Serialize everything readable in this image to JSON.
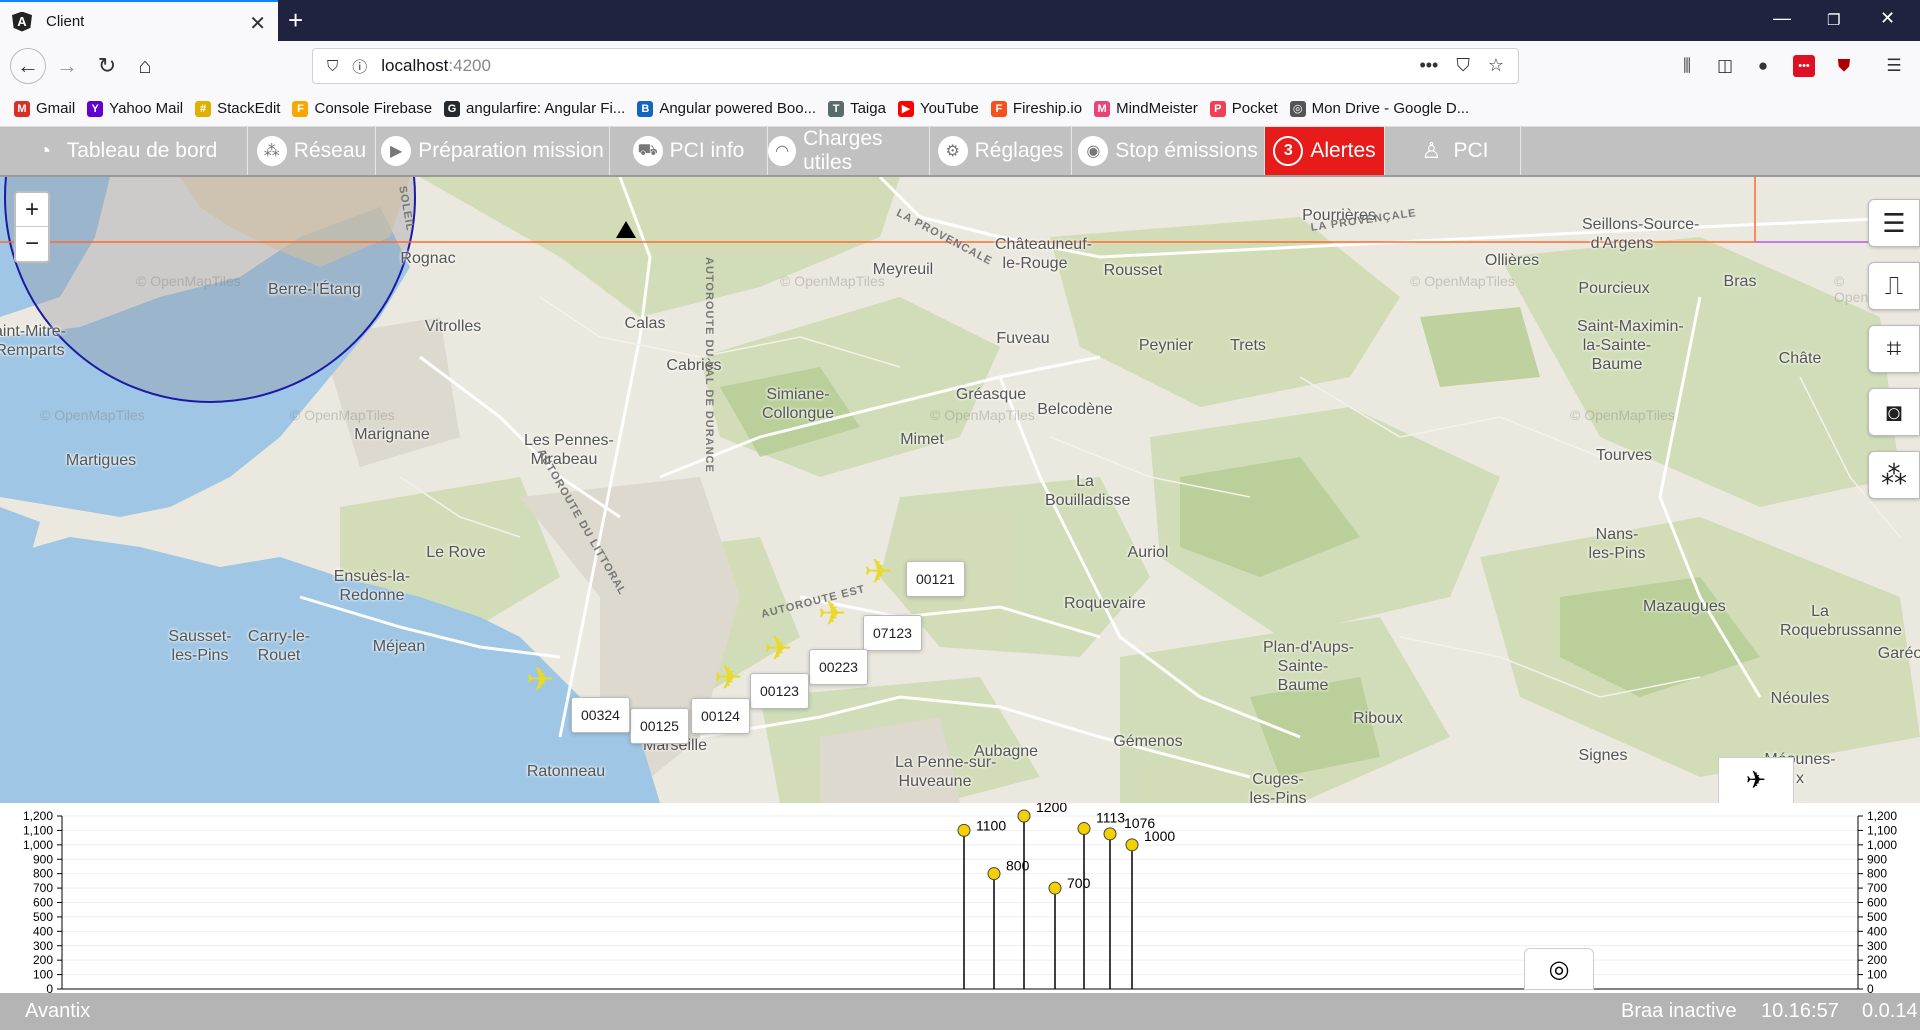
{
  "browser": {
    "tab_title": "Client",
    "tab_icon": "A",
    "url_host": "localhost",
    "url_port": ":4200",
    "bookmarks": [
      {
        "label": "Gmail",
        "icon": "gmail-icon",
        "color": "#d93025",
        "glyph": "M"
      },
      {
        "label": "Yahoo Mail",
        "icon": "yahoo-icon",
        "color": "#6001d2",
        "glyph": "Y"
      },
      {
        "label": "StackEdit",
        "icon": "stackedit-icon",
        "color": "#e0b000",
        "glyph": "#"
      },
      {
        "label": "Console Firebase",
        "icon": "firebase-icon",
        "color": "#f6a800",
        "glyph": "F"
      },
      {
        "label": "angularfire: Angular Fi...",
        "icon": "github-icon",
        "color": "#24292e",
        "glyph": "G"
      },
      {
        "label": "Angular powered Boo...",
        "icon": "bootstrap-icon",
        "color": "#1565c0",
        "glyph": "B"
      },
      {
        "label": "Taiga",
        "icon": "taiga-icon",
        "color": "#5a6b6b",
        "glyph": "T"
      },
      {
        "label": "YouTube",
        "icon": "youtube-icon",
        "color": "#ff0000",
        "glyph": "▶"
      },
      {
        "label": "Fireship.io",
        "icon": "fireship-icon",
        "color": "#f4511e",
        "glyph": "F"
      },
      {
        "label": "MindMeister",
        "icon": "mindmeister-icon",
        "color": "#e84576",
        "glyph": "M"
      },
      {
        "label": "Pocket",
        "icon": "pocket-icon",
        "color": "#ef4056",
        "glyph": "P"
      },
      {
        "label": "Mon Drive - Google D...",
        "icon": "globe-icon",
        "color": "#555555",
        "glyph": "◎"
      }
    ]
  },
  "menu": {
    "items": [
      {
        "label": "Tableau de bord",
        "icon": "dashboard-icon",
        "glyph": "◔"
      },
      {
        "label": "Réseau",
        "icon": "network-icon",
        "glyph": "⁂"
      },
      {
        "label": "Préparation mission",
        "icon": "play-icon",
        "glyph": "▶"
      },
      {
        "label": "PCI info",
        "icon": "truck-icon",
        "glyph": "⛟"
      },
      {
        "label": "Charges utiles",
        "icon": "wifi-icon",
        "glyph": "◠"
      },
      {
        "label": "Réglages",
        "icon": "settings-icon",
        "glyph": "⚙"
      },
      {
        "label": "Stop émissions",
        "icon": "stop-icon",
        "glyph": "◉"
      },
      {
        "label": "Alertes",
        "icon": "alert-badge",
        "glyph": "3"
      },
      {
        "label": "PCI",
        "icon": "user-icon",
        "glyph": "♙"
      }
    ],
    "alert_color": "#e81b1b"
  },
  "map": {
    "places": [
      {
        "name": "Rognac"
      },
      {
        "name": "Berre-l'Étang"
      },
      {
        "name": "Vitrolles"
      },
      {
        "name": "Calas"
      },
      {
        "name": "Meyreuil"
      },
      {
        "name": "Châteauneuf-\nle-Rouge"
      },
      {
        "name": "Rousset"
      },
      {
        "name": "Pourrières"
      },
      {
        "name": "Seillons-Source-\nd'Argens"
      },
      {
        "name": "Ollières"
      },
      {
        "name": "Bras"
      },
      {
        "name": "Pourcieux"
      },
      {
        "name": "Saint-Maximin-\nla-Sainte-\nBaume"
      },
      {
        "name": "aint-Mitre-\nRemparts"
      },
      {
        "name": "Cabriès"
      },
      {
        "name": "Simiane-\nCollongue"
      },
      {
        "name": "Fuveau"
      },
      {
        "name": "Peynier"
      },
      {
        "name": "Trets"
      },
      {
        "name": "Gréasque"
      },
      {
        "name": "Belcodène"
      },
      {
        "name": "Marignane"
      },
      {
        "name": "Les Pennes-\nMirabeau"
      },
      {
        "name": "Mimet"
      },
      {
        "name": "Martigues"
      },
      {
        "name": "La\nBouilladisse"
      },
      {
        "name": "Tourves"
      },
      {
        "name": "Nans-\nles-Pins"
      },
      {
        "name": "Le Rove"
      },
      {
        "name": "Auriol"
      },
      {
        "name": "Ensuès-la-\nRedonne"
      },
      {
        "name": "Roquevaire"
      },
      {
        "name": "Mazaugues"
      },
      {
        "name": "La\nRoquebrussanne"
      },
      {
        "name": "Sausset-\nles-Pins"
      },
      {
        "name": "Carry-le-\nRouet"
      },
      {
        "name": "Méjean"
      },
      {
        "name": "Plan-d'Aups-\nSainte-\nBaume"
      },
      {
        "name": "Garéo"
      },
      {
        "name": "Néoules"
      },
      {
        "name": "Riboux"
      },
      {
        "name": "Aubagne"
      },
      {
        "name": "Gémenos"
      },
      {
        "name": "La Penne-sur-\nHuveaune"
      },
      {
        "name": "Signes"
      },
      {
        "name": "Ratonneau"
      },
      {
        "name": "Cuges-\nles-Pins"
      },
      {
        "name": "Châte"
      },
      {
        "name": "Marseille"
      },
      {
        "name": "Méounes-\nx"
      }
    ],
    "road_labels": [
      "LA PROVENCALE",
      "LA PROVENÇALE",
      "AUTOROUTE DU VAL DE DURANCE",
      "AUTOROUTE DU LITTORAL",
      "AUTOROUTE EST",
      "SOLEIL"
    ],
    "watermark": "© OpenMapTiles",
    "zoom_in": "+",
    "zoom_out": "−",
    "tracks": [
      {
        "id": "00121"
      },
      {
        "id": "07123"
      },
      {
        "id": "00223"
      },
      {
        "id": "00123"
      },
      {
        "id": "00124"
      },
      {
        "id": "00125"
      },
      {
        "id": "00324"
      }
    ],
    "side_buttons": [
      {
        "icon": "list-icon",
        "glyph": "☰"
      },
      {
        "icon": "signal-icon",
        "glyph": "⎍"
      },
      {
        "icon": "polygon-icon",
        "glyph": "⌗"
      },
      {
        "icon": "headset-icon",
        "glyph": "◙"
      },
      {
        "icon": "network-icon",
        "glyph": "⁂"
      }
    ],
    "plane_color": "#e9d92c",
    "range_circle_color": "#1a1aa8",
    "line_color": "#ff6a2b"
  },
  "chart_data": {
    "type": "scatter",
    "style": "lollipop",
    "ylim": [
      0,
      1200
    ],
    "y_ticks": [
      "0",
      "100",
      "200",
      "300",
      "400",
      "500",
      "600",
      "700",
      "800",
      "900",
      "1,000",
      "1,100",
      "1,200"
    ],
    "points": [
      {
        "x": 0,
        "y": 1100,
        "label": "1100"
      },
      {
        "x": 1,
        "y": 800,
        "label": "800"
      },
      {
        "x": 2,
        "y": 1200,
        "label": "1200"
      },
      {
        "x": 3,
        "y": 700,
        "label": "700"
      },
      {
        "x": 4,
        "y": 1113,
        "label": "1113"
      },
      {
        "x": 5,
        "y": 1076,
        "label": "1076"
      },
      {
        "x": 6,
        "y": 1000,
        "label": "1000"
      }
    ],
    "marker_color": "#f5d000"
  },
  "status": {
    "app_name": "Avantix",
    "braa": "Braa inactive",
    "time": "10.16:57",
    "version": "0.0.14"
  }
}
